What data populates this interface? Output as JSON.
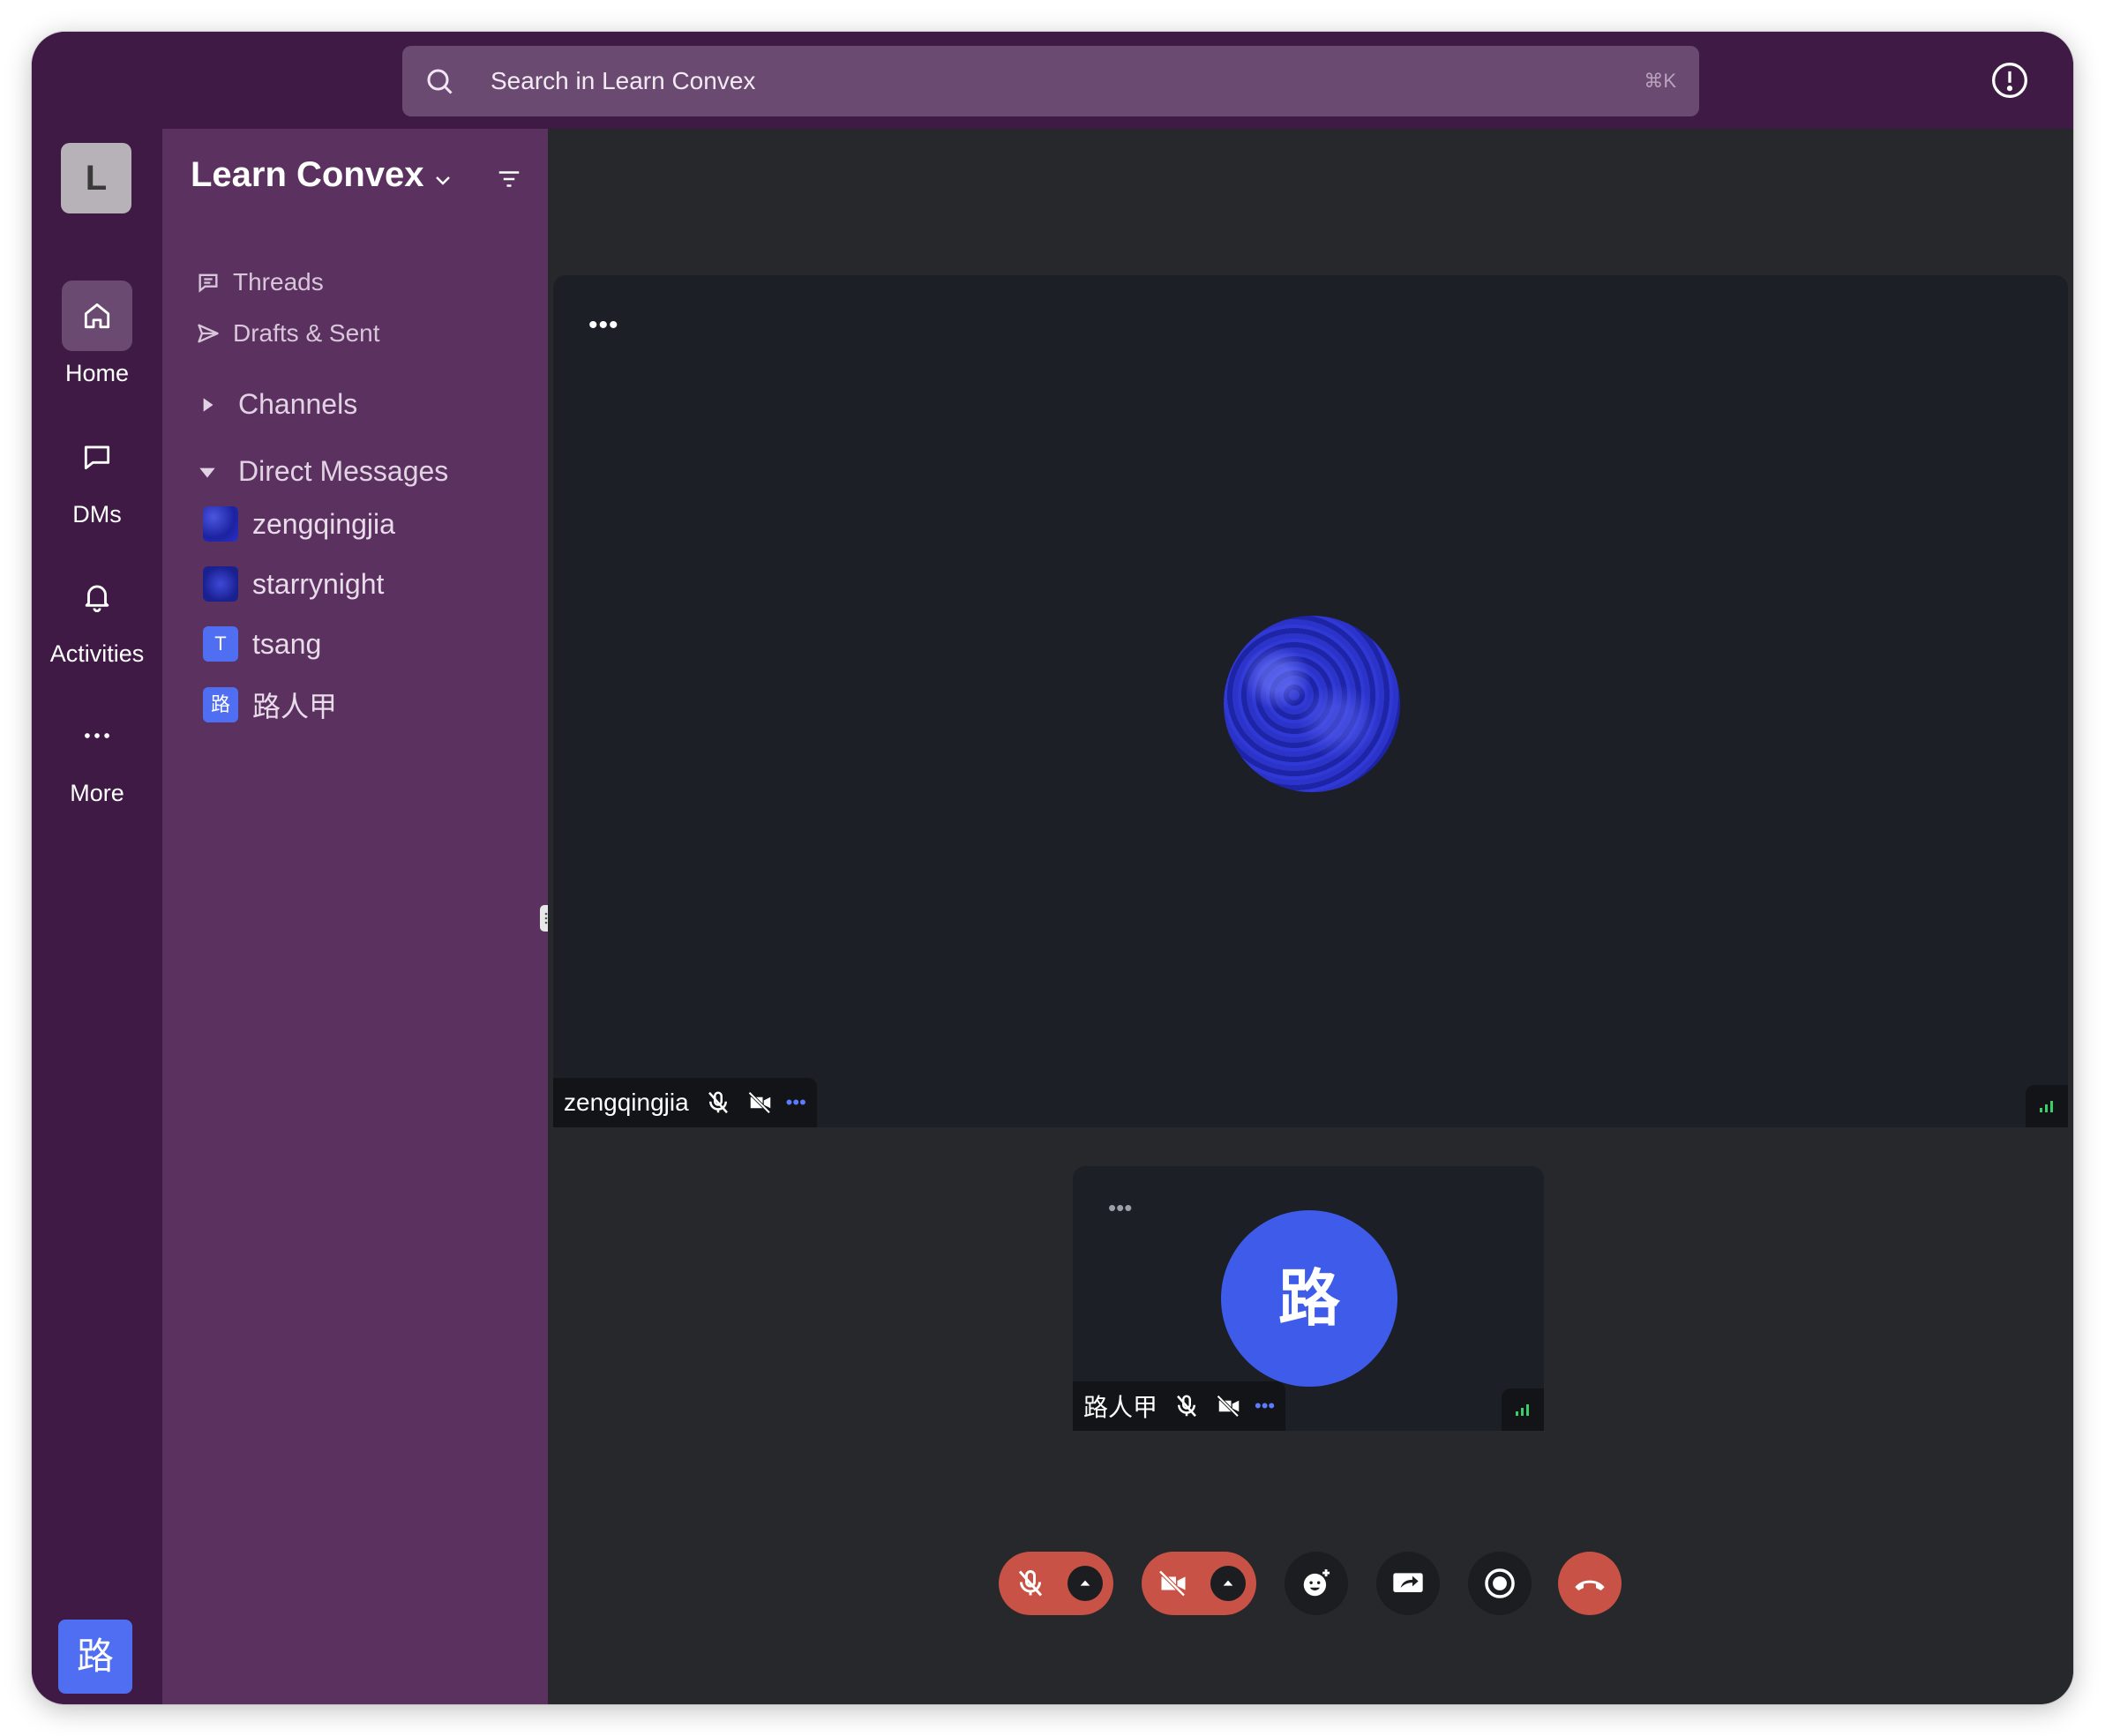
{
  "search": {
    "placeholder": "Search in Learn Convex",
    "shortcut": "⌘K"
  },
  "rail": {
    "workspace_initial": "L",
    "items": [
      {
        "label": "Home",
        "icon": "home-icon",
        "active": true
      },
      {
        "label": "DMs",
        "icon": "chat-icon",
        "active": false
      },
      {
        "label": "Activities",
        "icon": "bell-icon",
        "active": false
      },
      {
        "label": "More",
        "icon": "more-icon",
        "active": false
      }
    ],
    "user_initial": "路"
  },
  "sidebar": {
    "team_name": "Learn Convex",
    "nav": [
      {
        "label": "Threads",
        "icon": "threads-icon"
      },
      {
        "label": "Drafts & Sent",
        "icon": "send-icon"
      }
    ],
    "sections": {
      "channels": {
        "label": "Channels",
        "expanded": false
      },
      "direct_messages": {
        "label": "Direct Messages",
        "expanded": true
      }
    },
    "dms": [
      {
        "name": "zengqingjia",
        "avatar": "image"
      },
      {
        "name": "starrynight",
        "avatar": "image"
      },
      {
        "name": "tsang",
        "avatar_initial": "T"
      },
      {
        "name": "路人甲",
        "avatar_initial": "路"
      }
    ]
  },
  "call": {
    "main_participant": {
      "name": "zengqingjia",
      "muted": true,
      "video_off": true,
      "menu_glyph": "•••"
    },
    "self_participant": {
      "name": "路人甲",
      "initial": "路",
      "muted": true,
      "video_off": true,
      "menu_glyph": "•••"
    },
    "tile_menu_glyph": "•••"
  },
  "controls": [
    {
      "name": "mic-toggle",
      "state": "off"
    },
    {
      "name": "camera-toggle",
      "state": "off"
    },
    {
      "name": "reactions"
    },
    {
      "name": "share-screen"
    },
    {
      "name": "record"
    },
    {
      "name": "leave-call"
    }
  ],
  "colors": {
    "chrome": "#3e1a44",
    "sidebar": "#5b315f",
    "main_bg": "#26282c",
    "tile_bg": "#1c2026",
    "accent_blue": "#3e5bea",
    "danger": "#c75245"
  }
}
